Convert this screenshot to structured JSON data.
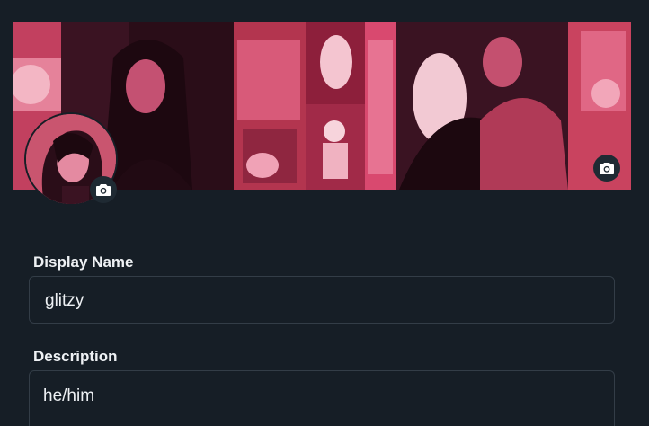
{
  "profile": {
    "banner_camera_icon": "camera-icon",
    "avatar_camera_icon": "camera-icon"
  },
  "form": {
    "display_name": {
      "label": "Display Name",
      "value": "glitzy"
    },
    "description": {
      "label": "Description",
      "value": "he/him"
    }
  },
  "colors": {
    "background": "#161e26",
    "banner_tint": "#d9496f",
    "field_border": "#333d47",
    "text": "#eef1f4"
  }
}
